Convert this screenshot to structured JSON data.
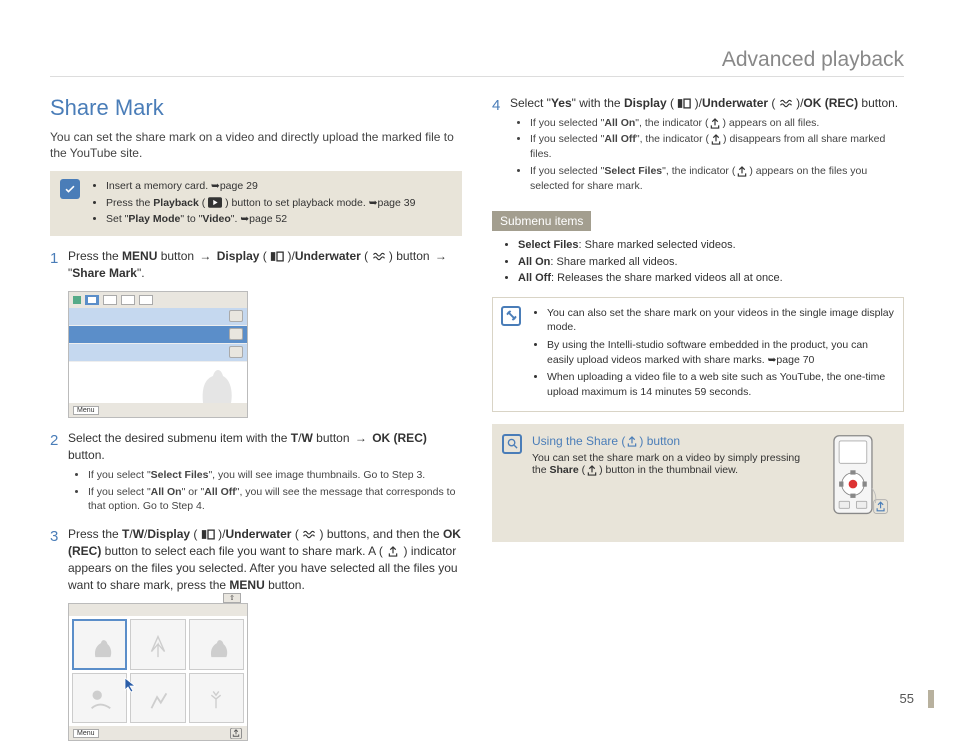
{
  "pageHeader": "Advanced playback",
  "pageNumber": "55",
  "sectionTitle": "Share Mark",
  "intro": "You can set the share mark on a video and directly upload the marked file to the YouTube site.",
  "prereq": {
    "items": [
      {
        "text": "Insert a memory card. ",
        "ref": "page 29"
      },
      {
        "prefix": "Press the ",
        "bold1": "Playback",
        "mid": " (",
        "iconName": "playback",
        "mid2": ") button to set playback mode. ",
        "ref": "page 39"
      },
      {
        "prefix": "Set \"",
        "bold1": "Play Mode",
        "mid": "\" to \"",
        "bold2": "Video",
        "suffix": "\". ",
        "ref": "page 52"
      }
    ]
  },
  "steps": {
    "s1": {
      "num": "1",
      "t1": "Press the ",
      "b1": "MENU",
      "t2": " button ",
      "b2": "Display",
      "t3": " (",
      "t4": ")/",
      "b3": "Underwater",
      "t5": " (",
      "t6": ") button ",
      "t7": " \"",
      "b4": "Share Mark",
      "t8": "\"."
    },
    "s2": {
      "num": "2",
      "t1": "Select the desired submenu item with the ",
      "b1": "T",
      "t2": "/",
      "b2": "W",
      "t3": " button ",
      "b3": "OK (REC)",
      "t4": " button.",
      "bullets": [
        {
          "p": "If you select \"",
          "b": "Select Files",
          "s": "\", you will see image thumbnails. Go to Step 3."
        },
        {
          "p": "If you select \"",
          "b": "All On",
          "m": "\" or \"",
          "b2": "All Off",
          "s": "\", you will see the message that corresponds to that option. Go to Step 4."
        }
      ]
    },
    "s3": {
      "num": "3",
      "t1": "Press the ",
      "b1": "T",
      "t2": "/",
      "b2": "W",
      "t3": "/",
      "b3": "Display",
      "t4": " (",
      "t5": ")/",
      "b4": "Underwater",
      "t6": " (",
      "t7": ") buttons, and then the ",
      "b5": "OK (REC)",
      "t8": " button to select each file you want to share mark. A (",
      "t9": ") indicator appears on the files you selected. After you have selected all the files you want to share mark, press the ",
      "b6": "MENU",
      "t10": " button."
    },
    "s4": {
      "num": "4",
      "t1": "Select \"",
      "b1": "Yes",
      "t2": "\" with the ",
      "b2": "Display",
      "t3": " (",
      "t4": ")/",
      "b3": "Underwater",
      "t5": " (",
      "t6": ")/",
      "b4": "OK (REC)",
      "t7": " button.",
      "bullets": [
        {
          "p": "If you selected \"",
          "b": "All On",
          "m": "\", the indicator (",
          "s": ") appears on all files."
        },
        {
          "p": "If you selected \"",
          "b": "All Off",
          "m": "\", the indicator (",
          "s": ") disappears from all share marked files."
        },
        {
          "p": "If you selected \"",
          "b": "Select Files",
          "m": "\", the indicator (",
          "s": ") appears on the files you selected for share mark."
        }
      ]
    }
  },
  "submenu": {
    "header": "Submenu items",
    "items": [
      {
        "b": "Select Files",
        "t": ": Share marked selected videos."
      },
      {
        "b": "All On",
        "t": ": Share marked all videos."
      },
      {
        "b": "All Off",
        "t": ": Releases the share marked videos all at once."
      }
    ]
  },
  "notes": [
    "You can also set the share mark on your videos in the single image display mode.",
    {
      "t1": "By using the Intelli-studio software embedded in the product, you can easily upload videos marked with share marks. ",
      "ref": "page 70"
    },
    "When uploading a video file to a web site such as YouTube, the one-time upload maximum is 14 minutes 59 seconds."
  ],
  "tip": {
    "title_pre": "Using the Share (",
    "title_post": ") button",
    "body_pre": "You can set the share mark on a video by simply pressing the ",
    "body_bold": "Share",
    "body_mid": " (",
    "body_post": ") button in the thumbnail view."
  },
  "screenshot": {
    "menuLabel": "Menu"
  }
}
